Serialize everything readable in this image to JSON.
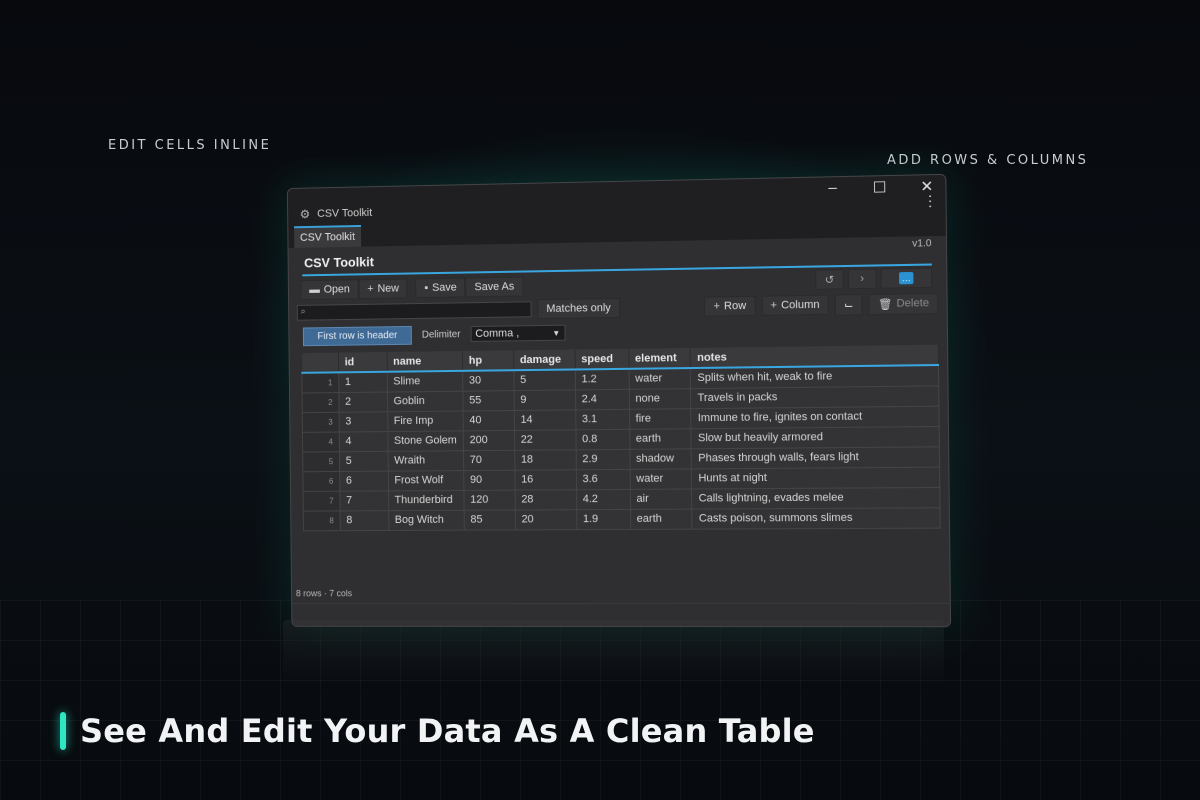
{
  "captions": {
    "left": "EDIT CELLS INLINE",
    "right": "ADD ROWS & COLUMNS"
  },
  "headline": "See And Edit Your Data As A Clean Table",
  "window": {
    "title": "CSV Toolkit",
    "tab": "CSV Toolkit",
    "panel_title": "CSV Toolkit",
    "version": "v1.0"
  },
  "toolbar": {
    "open": "Open",
    "new": "New",
    "save": "Save",
    "save_as": "Save As",
    "matches_only": "Matches only",
    "add_row": "Row",
    "add_column": "Column",
    "delete": "Delete",
    "first_row_header": "First row is header",
    "delimiter_label": "Delimiter",
    "delimiter_value": "Comma  ,",
    "search_placeholder": ""
  },
  "table": {
    "columns": [
      "id",
      "name",
      "hp",
      "damage",
      "speed",
      "element",
      "notes"
    ],
    "rows": [
      [
        "1",
        "1",
        "Slime",
        "30",
        "5",
        "1.2",
        "water",
        "Splits when hit, weak to fire"
      ],
      [
        "2",
        "2",
        "Goblin",
        "55",
        "9",
        "2.4",
        "none",
        "Travels in packs"
      ],
      [
        "3",
        "3",
        "Fire Imp",
        "40",
        "14",
        "3.1",
        "fire",
        "Immune to fire, ignites on contact"
      ],
      [
        "4",
        "4",
        "Stone Golem",
        "200",
        "22",
        "0.8",
        "earth",
        "Slow but heavily armored"
      ],
      [
        "5",
        "5",
        "Wraith",
        "70",
        "18",
        "2.9",
        "shadow",
        "Phases through walls, fears light"
      ],
      [
        "6",
        "6",
        "Frost Wolf",
        "90",
        "16",
        "3.6",
        "water",
        "Hunts at night"
      ],
      [
        "7",
        "7",
        "Thunderbird",
        "120",
        "28",
        "4.2",
        "air",
        "Calls lightning, evades melee"
      ],
      [
        "8",
        "8",
        "Bog Witch",
        "85",
        "20",
        "1.9",
        "earth",
        "Casts poison, summons slimes"
      ]
    ]
  },
  "status": "8 rows · 7 cols",
  "colors": {
    "accent": "#39a6e0",
    "headline_bar": "#2ee6c4"
  }
}
